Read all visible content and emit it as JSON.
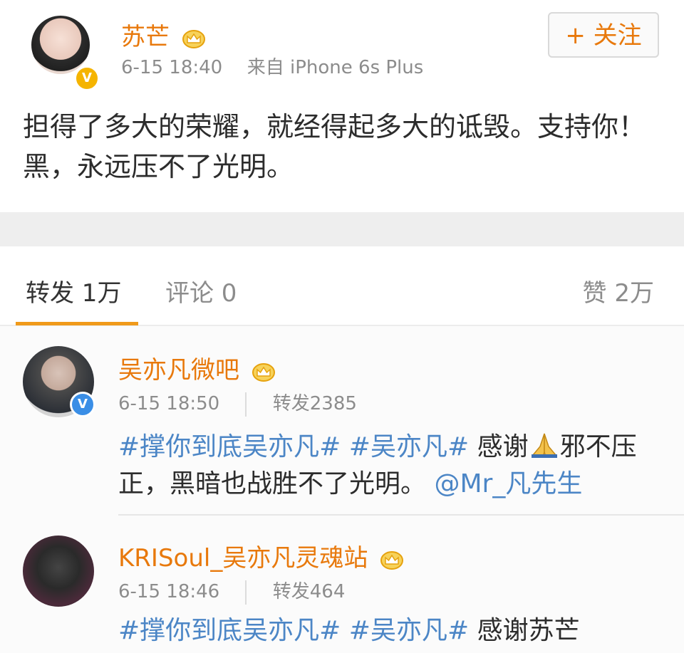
{
  "post": {
    "username": "苏芒",
    "time": "6-15 18:40",
    "source": "来自 iPhone 6s Plus",
    "follow_label": "+ 关注",
    "text": "担得了多大的荣耀，就经得起多大的诋毁。支持你！黑，永远压不了光明。",
    "icons": [
      "crown-icon",
      "verified-icon"
    ]
  },
  "tabs": {
    "repost": "转发 1万",
    "comment": "评论 0",
    "like": "赞 2万"
  },
  "reposts": [
    {
      "username": "吴亦凡微吧",
      "time": "6-15 18:50",
      "repost_count": "转发2385",
      "hashtag1": "#撑你到底吴亦凡#",
      "hashtag2": "#吴亦凡#",
      "text_a": "感谢",
      "text_b": "邪不压正，黑暗也战胜不了光明。",
      "mention": "@Mr_凡先生"
    },
    {
      "username": "KRISoul_吴亦凡灵魂站",
      "time": "6-15 18:46",
      "repost_count": "转发464",
      "hashtag1": "#撑你到底吴亦凡#",
      "hashtag2": "#吴亦凡#",
      "text_a": "感谢苏芒"
    }
  ],
  "colors": {
    "accent": "#e8790c",
    "link": "#4c86c6",
    "tab_underline": "#f09a1a"
  }
}
